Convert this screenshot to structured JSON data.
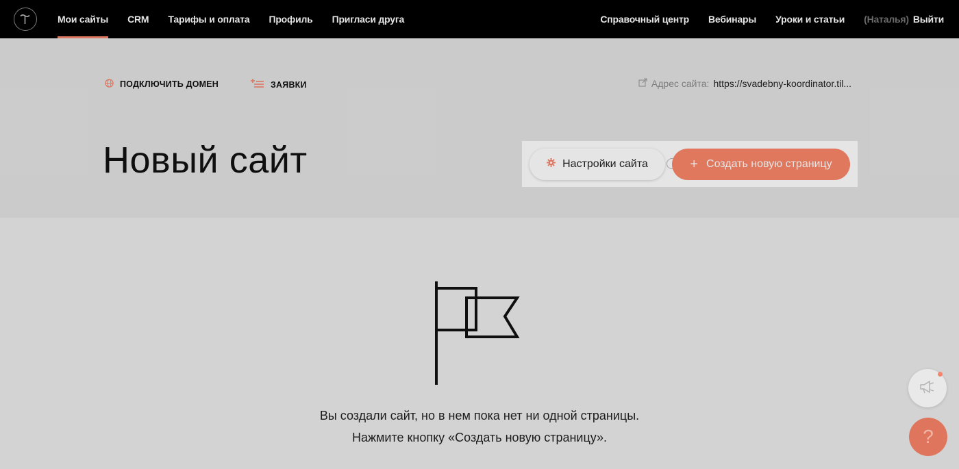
{
  "topbar": {
    "logo_icon": "tilda-logo-icon",
    "nav_left": [
      {
        "label": "Мои сайты",
        "active": true
      },
      {
        "label": "CRM"
      },
      {
        "label": "Тарифы и оплата"
      },
      {
        "label": "Профиль"
      },
      {
        "label": "Пригласи друга"
      }
    ],
    "nav_right": {
      "help_center": "Справочный центр",
      "webinars": "Вебинары",
      "lessons": "Уроки и статьи",
      "user_name": "(Наталья)",
      "logout": "Выйти"
    }
  },
  "header": {
    "connect_domain": "ПОДКЛЮЧИТЬ ДОМЕН",
    "leads": "ЗАЯВКИ",
    "site_address_label": "Адрес сайта:",
    "site_address_value": "https://svadebny-koordinator.til...",
    "page_title": "Новый сайт",
    "settings_button": "Настройки сайта",
    "create_button": "Создать новую страницу",
    "create_button_plus": "+"
  },
  "empty_state": {
    "icon": "flag-icon",
    "line1": "Вы создали сайт, но в нем пока нет ни одной страницы.",
    "line2": "Нажмите кнопку «Создать новую страницу»."
  },
  "floating": {
    "news_icon": "megaphone-icon",
    "help_label": "?"
  },
  "colors": {
    "accent": "#fa8669",
    "topbar_bg": "#000000",
    "background": "#e3e3e3"
  }
}
